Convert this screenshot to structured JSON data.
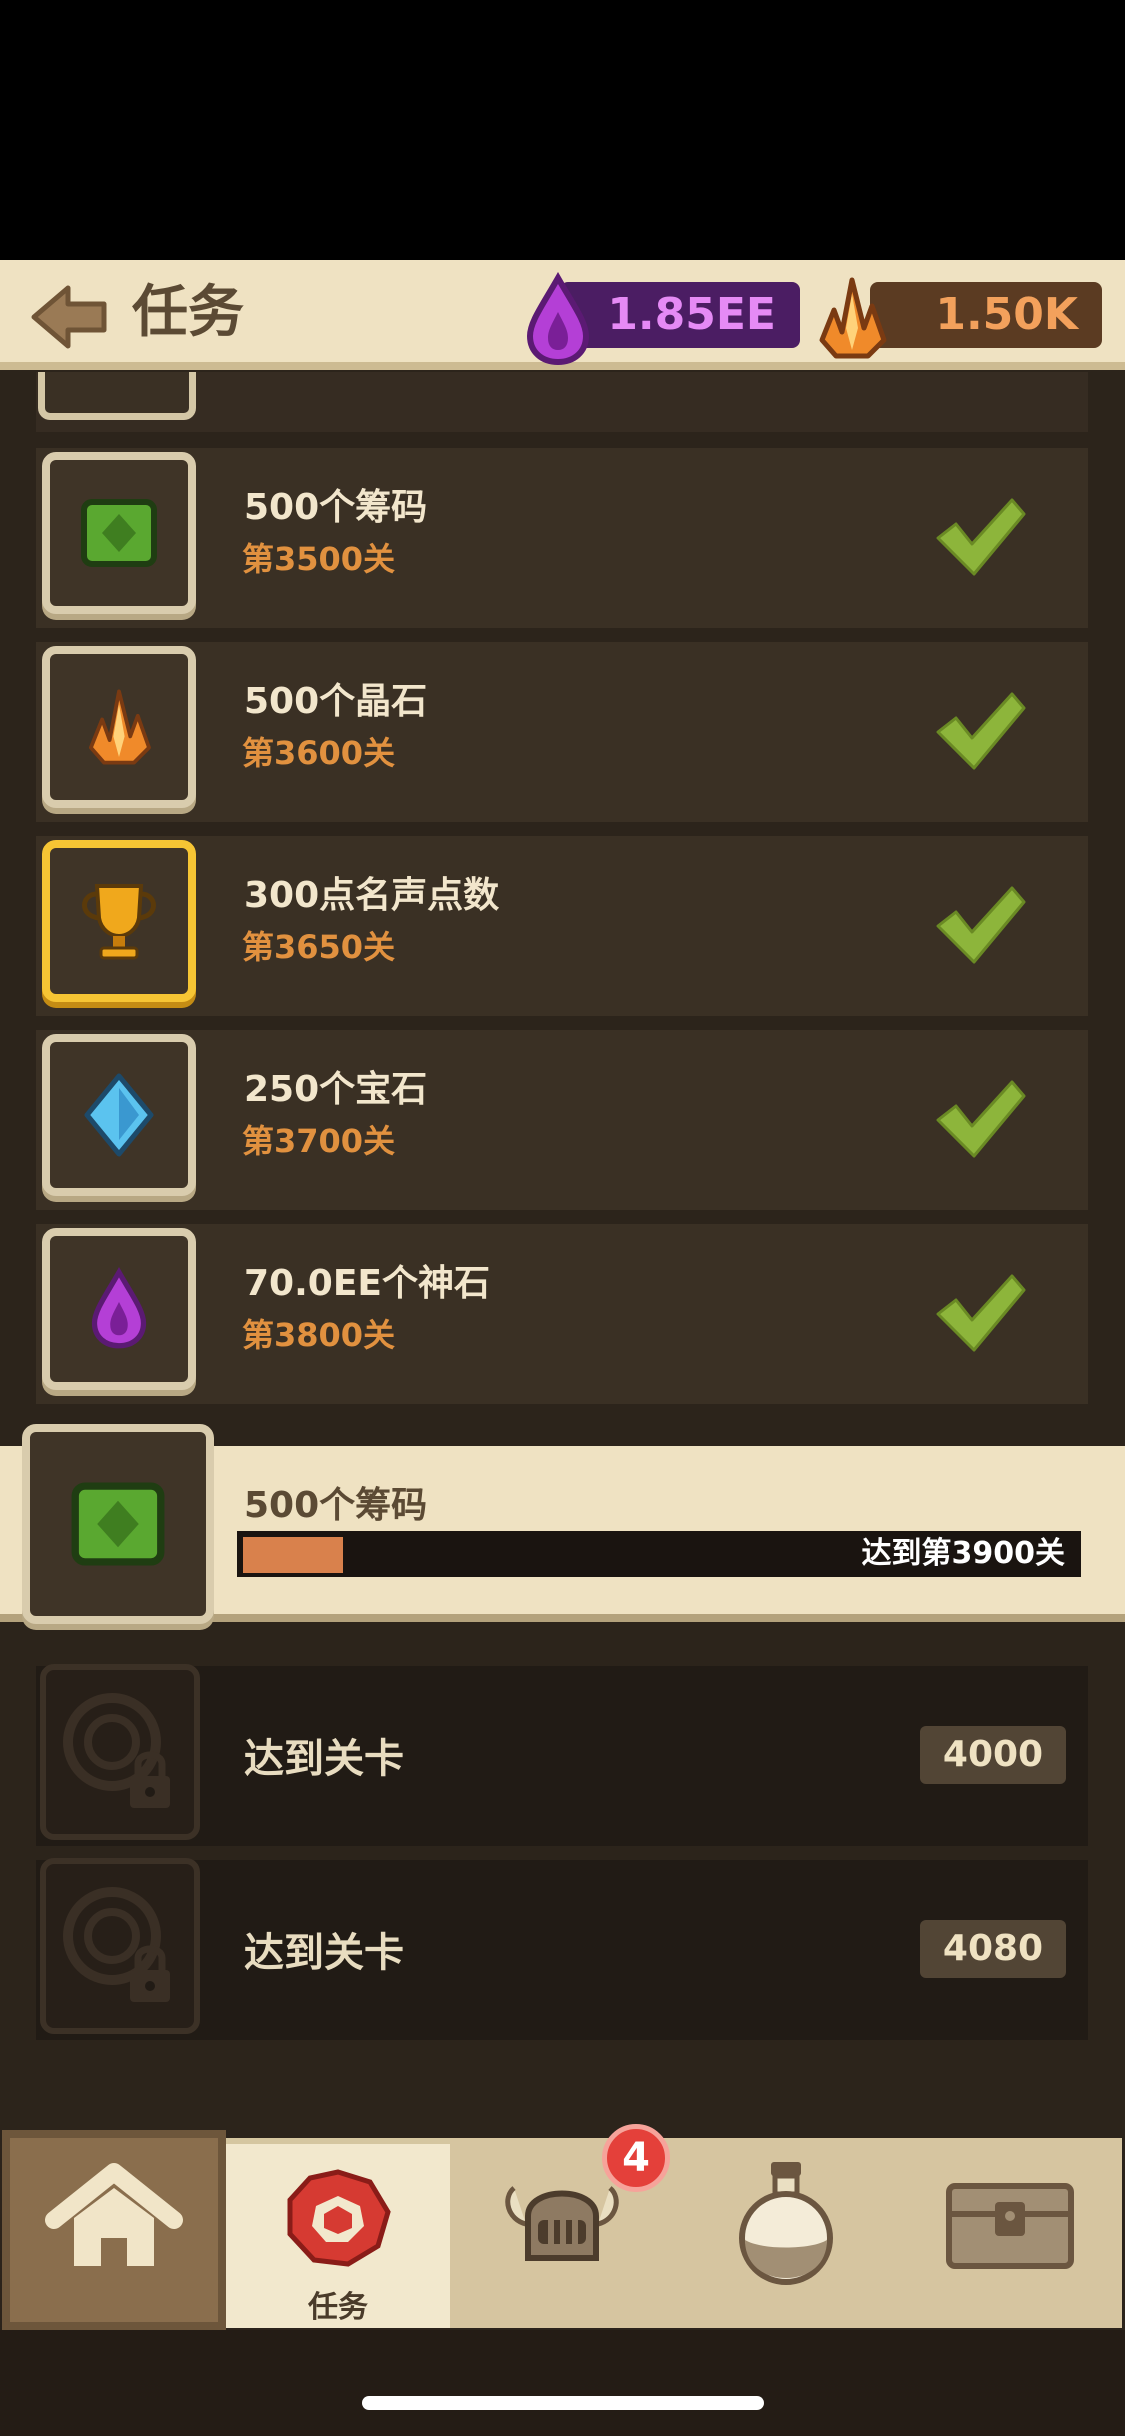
{
  "header": {
    "title": "任务",
    "currency_purple": "1.85EE",
    "currency_orange": "1.50K",
    "colors": {
      "header_bg": "#efe2c2",
      "purple": "#e58af5",
      "orange": "#f3a15c"
    }
  },
  "completed_tasks": [
    {
      "reward": "500个筹码",
      "stage": "第3500关",
      "icon": "chip-icon"
    },
    {
      "reward": "500个晶石",
      "stage": "第3600关",
      "icon": "crystal-icon"
    },
    {
      "reward": "300点名声点数",
      "stage": "第3650关",
      "icon": "trophy-icon"
    },
    {
      "reward": "250个宝石",
      "stage": "第3700关",
      "icon": "gem-icon"
    },
    {
      "reward": "70.0EE个神石",
      "stage": "第3800关",
      "icon": "purple-drop-icon"
    }
  ],
  "current_task": {
    "reward": "500个筹码",
    "progress_text": "达到第3900关",
    "progress_fraction": 0.12,
    "icon": "chip-icon"
  },
  "locked_tasks": [
    {
      "label": "达到关卡",
      "level": "4000"
    },
    {
      "label": "达到关卡",
      "level": "4080"
    }
  ],
  "tabs": {
    "task_label": "任务",
    "hero_badge": "4"
  }
}
